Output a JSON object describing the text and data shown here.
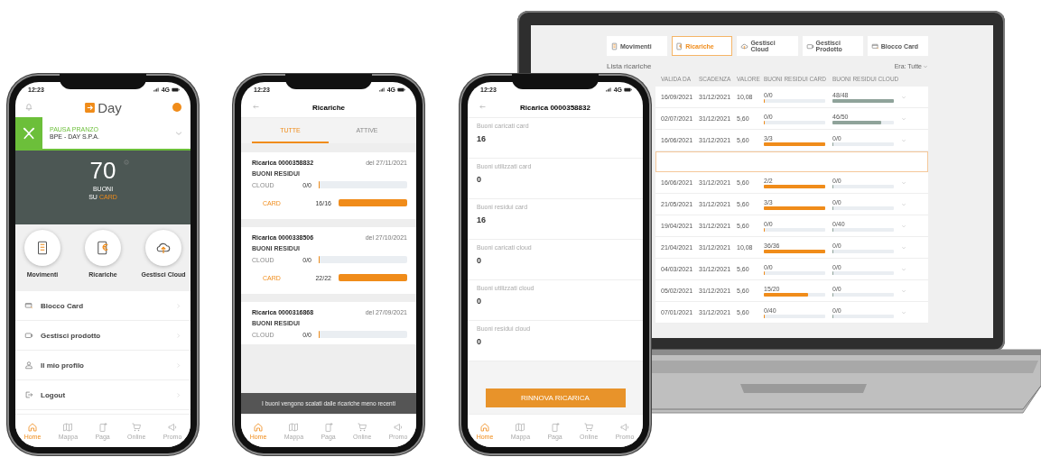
{
  "phones": [
    {
      "kind": "home",
      "status": {
        "time": "12:23",
        "network": "4G"
      },
      "header": {
        "logo_text": "Day"
      },
      "company": {
        "label": "PAUSA PRANZO",
        "name": "BPE - DAY S.P.A."
      },
      "balance": {
        "value": "70",
        "line1": "BUONI",
        "prefix": "SU",
        "highlight": "CARD"
      },
      "actions": [
        {
          "kind": "movements",
          "label": "Movimenti"
        },
        {
          "kind": "recharges",
          "label": "Ricariche"
        },
        {
          "kind": "cloud",
          "label": "Gestisci Cloud"
        }
      ],
      "menu": [
        {
          "kind": "card",
          "label": "Blocco Card"
        },
        {
          "kind": "product",
          "label": "Gestisci prodotto"
        },
        {
          "kind": "profile",
          "label": "Il mio profilo"
        },
        {
          "kind": "logout",
          "label": "Logout"
        }
      ],
      "tabbar": [
        {
          "kind": "home",
          "label": "Home",
          "selected": true
        },
        {
          "kind": "map",
          "label": "Mappa",
          "selected": false
        },
        {
          "kind": "pay",
          "label": "Paga",
          "selected": false
        },
        {
          "kind": "online",
          "label": "Online",
          "selected": false
        },
        {
          "kind": "promo",
          "label": "Promo",
          "selected": false
        }
      ]
    },
    {
      "kind": "recharges",
      "status": {
        "time": "12:23",
        "network": "4G"
      },
      "title": "Ricariche",
      "tabs": [
        {
          "label": "TUTTE",
          "selected": true
        },
        {
          "label": "ATTIVE",
          "selected": false
        }
      ],
      "cards": [
        {
          "title": "Ricarica 0000358832",
          "date": "del 27/11/2021",
          "subtitle": "BUONI RESIDUI",
          "rows": [
            {
              "kind": "cloud",
              "label": "CLOUD",
              "value": "0/0",
              "level": 0
            },
            {
              "kind": "card",
              "label": "CARD",
              "value": "16/16",
              "level": 1
            }
          ]
        },
        {
          "title": "Ricarica 0000338506",
          "date": "del 27/10/2021",
          "subtitle": "BUONI RESIDUI",
          "rows": [
            {
              "kind": "cloud",
              "label": "CLOUD",
              "value": "0/0",
              "level": 0
            },
            {
              "kind": "card",
              "label": "CARD",
              "value": "22/22",
              "level": 1
            }
          ]
        },
        {
          "title": "Ricarica 0000316868",
          "date": "del 27/09/2021",
          "subtitle": "BUONI RESIDUI",
          "rows": [
            {
              "kind": "cloud",
              "label": "CLOUD",
              "value": "0/0",
              "level": 0
            }
          ]
        }
      ],
      "toast": "I buoni vengono scalati dalle ricariche meno recenti",
      "tabbar": [
        {
          "kind": "home",
          "label": "Home",
          "selected": true
        },
        {
          "kind": "map",
          "label": "Mappa",
          "selected": false
        },
        {
          "kind": "pay",
          "label": "Paga",
          "selected": false
        },
        {
          "kind": "online",
          "label": "Online",
          "selected": false
        },
        {
          "kind": "promo",
          "label": "Promo",
          "selected": false
        }
      ]
    },
    {
      "kind": "detail",
      "status": {
        "time": "12:23",
        "network": "4G"
      },
      "title": "Ricarica 0000358832",
      "fields": [
        {
          "label": "Buoni caricati card",
          "value": "16"
        },
        {
          "label": "Buoni utilizzati card",
          "value": "0"
        },
        {
          "label": "Buoni residui card",
          "value": "16"
        },
        {
          "label": "Buoni caricati cloud",
          "value": "0"
        },
        {
          "label": "Buoni utilizzati cloud",
          "value": "0"
        },
        {
          "label": "Buoni residui cloud",
          "value": "0"
        }
      ],
      "button": "RINNOVA RICARICA",
      "tabbar": [
        {
          "kind": "home",
          "label": "Home",
          "selected": true
        },
        {
          "kind": "map",
          "label": "Mappa",
          "selected": false
        },
        {
          "kind": "pay",
          "label": "Paga",
          "selected": false
        },
        {
          "kind": "online",
          "label": "Online",
          "selected": false
        },
        {
          "kind": "promo",
          "label": "Promo",
          "selected": false
        }
      ]
    }
  ],
  "laptop": {
    "tabs": [
      {
        "kind": "movements",
        "label": "Movimenti",
        "selected": false
      },
      {
        "kind": "recharges",
        "label": "Ricariche",
        "selected": true
      },
      {
        "kind": "cloud",
        "label": "Gestisci Cloud",
        "selected": false
      },
      {
        "kind": "product",
        "label": "Gestisci Prodotto",
        "selected": false
      },
      {
        "kind": "card",
        "label": "Blocco Card",
        "selected": false
      }
    ],
    "list_title": "Lista ricariche",
    "filter": "Era: Tutte",
    "columns": [
      "VALIDA DA",
      "SCADENZA",
      "VALORE",
      "BUONI RESIDUI CARD",
      "BUONI RESIDUI CLOUD"
    ],
    "rows": [
      {
        "valid_from": "16/09/2021",
        "expiry": "31/12/2021",
        "value": "10,08",
        "card": {
          "value": "0/0",
          "level": 0
        },
        "cloud": {
          "value": "48/48",
          "level": 1
        },
        "expanded": false
      },
      {
        "valid_from": "02/07/2021",
        "expiry": "31/12/2021",
        "value": "5,60",
        "card": {
          "value": "0/0",
          "level": 0
        },
        "cloud": {
          "value": "46/50",
          "level": 0.8
        },
        "expanded": false
      },
      {
        "valid_from": "16/06/2021",
        "expiry": "31/12/2021",
        "value": "5,60",
        "card": {
          "value": "3/3",
          "level": 1
        },
        "cloud": {
          "value": "0/0",
          "level": 0
        },
        "expanded": true
      },
      {
        "valid_from": "16/06/2021",
        "expiry": "31/12/2021",
        "value": "5,60",
        "card": {
          "value": "2/2",
          "level": 1
        },
        "cloud": {
          "value": "0/0",
          "level": 0
        },
        "expanded": false
      },
      {
        "valid_from": "21/05/2021",
        "expiry": "31/12/2021",
        "value": "5,60",
        "card": {
          "value": "3/3",
          "level": 1
        },
        "cloud": {
          "value": "0/0",
          "level": 0
        },
        "expanded": false
      },
      {
        "valid_from": "19/04/2021",
        "expiry": "31/12/2021",
        "value": "5,60",
        "card": {
          "value": "0/0",
          "level": 0
        },
        "cloud": {
          "value": "0/40",
          "level": 0
        },
        "expanded": false
      },
      {
        "valid_from": "21/04/2021",
        "expiry": "31/12/2021",
        "value": "10,08",
        "card": {
          "value": "36/36",
          "level": 1
        },
        "cloud": {
          "value": "0/0",
          "level": 0
        },
        "expanded": false
      },
      {
        "valid_from": "04/03/2021",
        "expiry": "31/12/2021",
        "value": "5,60",
        "card": {
          "value": "0/0",
          "level": 0
        },
        "cloud": {
          "value": "0/0",
          "level": 0
        },
        "expanded": false
      },
      {
        "valid_from": "05/02/2021",
        "expiry": "31/12/2021",
        "value": "5,60",
        "card": {
          "value": "15/20",
          "level": 0.72
        },
        "cloud": {
          "value": "0/0",
          "level": 0
        },
        "expanded": false
      },
      {
        "valid_from": "07/01/2021",
        "expiry": "31/12/2021",
        "value": "5,60",
        "card": {
          "value": "0/40",
          "level": 0
        },
        "cloud": {
          "value": "0/0",
          "level": 0
        },
        "expanded": false
      }
    ]
  }
}
